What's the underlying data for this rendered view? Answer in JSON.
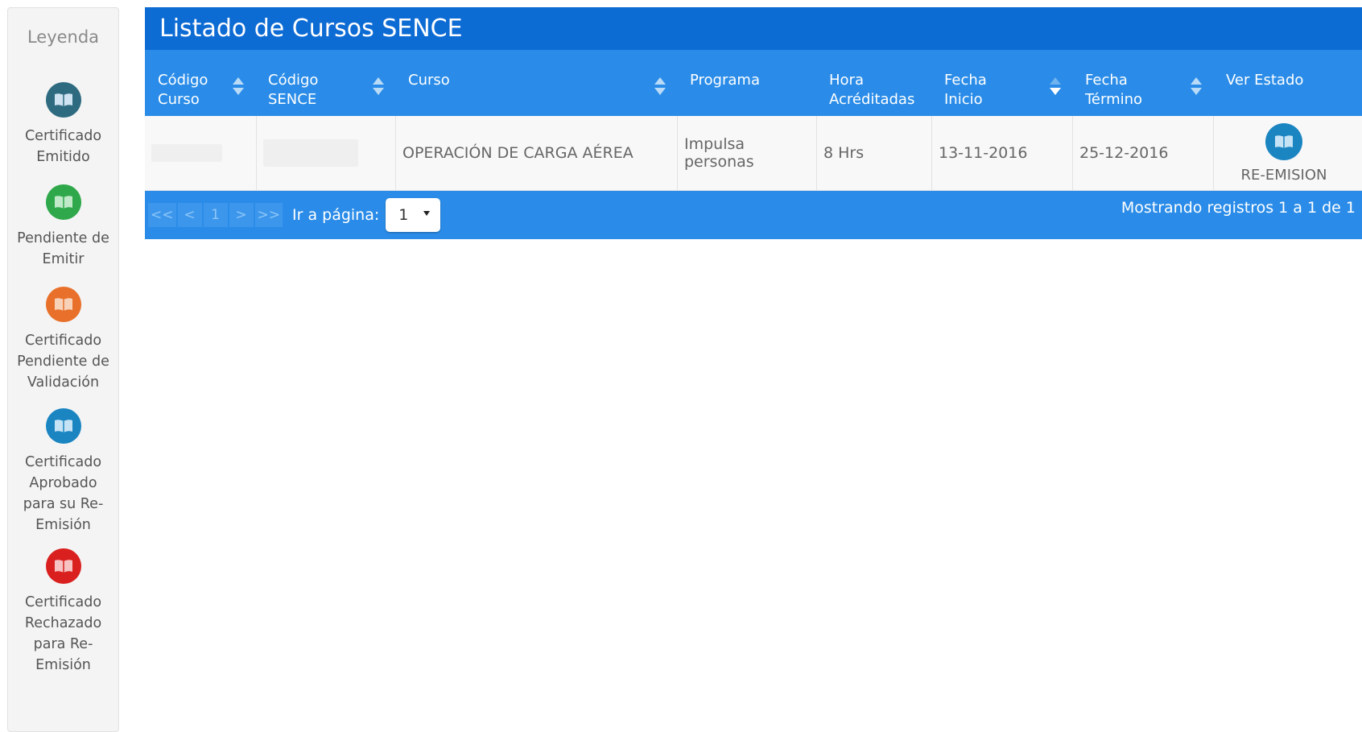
{
  "legend": {
    "title": "Leyenda",
    "items": [
      {
        "label": "Certificado Emitido",
        "color": "#2f6b80"
      },
      {
        "label": "Pendiente de Emitir",
        "color": "#2ea84a"
      },
      {
        "label": "Certificado Pendiente de Validación",
        "color": "#e8702a"
      },
      {
        "label": "Certificado Aprobado para su Re-Emisión",
        "color": "#1b85c2"
      },
      {
        "label": "Certificado Rechazado para Re-Emisión",
        "color": "#d9201f"
      }
    ]
  },
  "panel": {
    "title": "Listado de Cursos SENCE",
    "header_color": "#0d6bd4",
    "table_color": "#2a8ce8"
  },
  "table": {
    "columns": [
      {
        "line1": "Código",
        "line2": "Curso",
        "sortable": true
      },
      {
        "line1": "Código",
        "line2": "SENCE",
        "sortable": true
      },
      {
        "line1": "Curso",
        "line2": "",
        "sortable": true
      },
      {
        "line1": "Programa",
        "line2": "",
        "sortable": false
      },
      {
        "line1": "Hora",
        "line2": "Acréditadas",
        "sortable": false
      },
      {
        "line1": "Fecha",
        "line2": "Inicio",
        "sortable": true,
        "sorted": "desc"
      },
      {
        "line1": "Fecha",
        "line2": "Término",
        "sortable": true
      },
      {
        "line1": "Ver Estado",
        "line2": "",
        "sortable": false
      }
    ],
    "rows": [
      {
        "curso": "OPERACIÓN DE CARGA AÉREA",
        "programa": "Impulsa personas",
        "horas": "8 Hrs",
        "fecha_inicio": "13-11-2016",
        "fecha_termino": "25-12-2016",
        "estado_label": "RE-EMISION",
        "estado_icon": "book-icon"
      }
    ]
  },
  "pager": {
    "first": "<<",
    "prev": "<",
    "page": "1",
    "next": ">",
    "last": ">>",
    "goto_label": "Ir a página:",
    "selected_page": "1",
    "info": "Mostrando registros 1 a 1 de 1"
  }
}
